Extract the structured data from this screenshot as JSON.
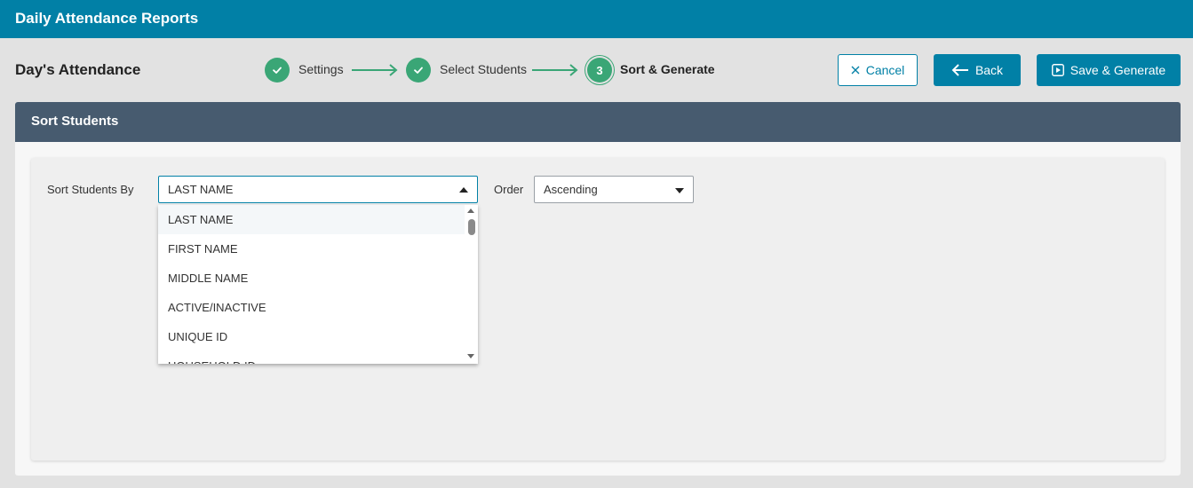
{
  "app": {
    "title": "Daily Attendance Reports"
  },
  "page": {
    "title": "Day's Attendance"
  },
  "steps": [
    {
      "label": "Settings",
      "state": "complete",
      "icon": "check-icon"
    },
    {
      "label": "Select Students",
      "state": "complete",
      "icon": "check-icon"
    },
    {
      "number": "3",
      "label": "Sort & Generate",
      "state": "current"
    }
  ],
  "actions": {
    "cancel_label": "Cancel",
    "back_label": "Back",
    "save_label": "Save & Generate"
  },
  "panel": {
    "title": "Sort Students"
  },
  "form": {
    "sort_by_label": "Sort Students By",
    "sort_by_value": "LAST NAME",
    "order_label": "Order",
    "order_value": "Ascending"
  },
  "dropdown": {
    "options": [
      "LAST NAME",
      "FIRST NAME",
      "MIDDLE NAME",
      "ACTIVE/INACTIVE",
      "UNIQUE ID",
      "HOUSEHOLD ID"
    ],
    "selected_index": 0
  },
  "colors": {
    "brand": "#0180a6",
    "step_complete": "#3aa676",
    "panel_header": "#475b6f"
  }
}
